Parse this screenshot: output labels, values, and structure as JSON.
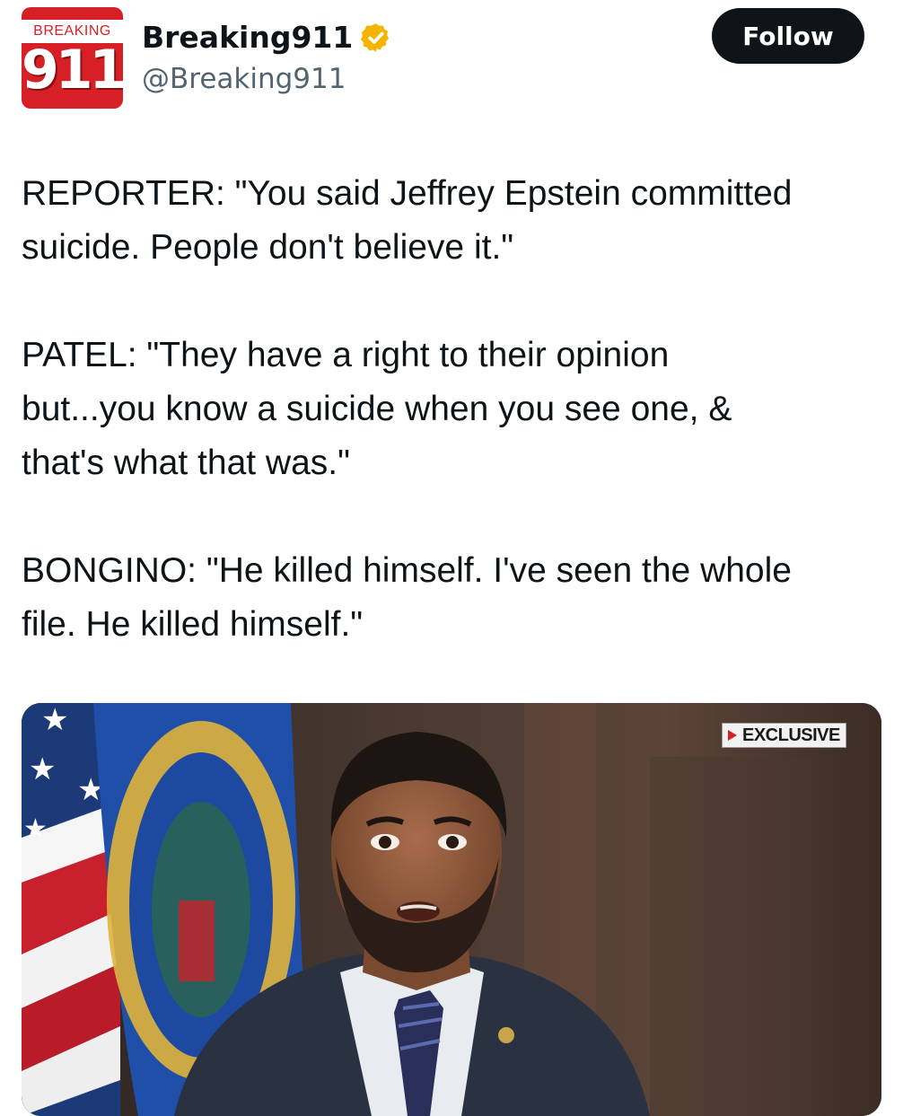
{
  "account": {
    "avatar_word": "BREAKING",
    "avatar_number": "911",
    "display_name": "Breaking911",
    "handle": "@Breaking911",
    "verified_icon": "verified-badge-icon",
    "verified_color": "#f4b400"
  },
  "follow_button": {
    "label": "Follow"
  },
  "tweet": {
    "paragraphs": [
      "REPORTER: \"You said Jeffrey Epstein committed\nsuicide. People don't believe it.\"",
      "PATEL: \"They have a right to their opinion\nbut...you know a suicide when you see one, &\nthat's what that was.\"",
      "BONGINO: \"He killed himself. I've seen the whole\nfile. He killed himself.\""
    ]
  },
  "media": {
    "badge_label": "EXCLUSIVE",
    "badge_icon": "play-triangle-icon"
  },
  "colors": {
    "text": "#0f1419",
    "secondary": "#536471",
    "brand_red": "#d71f26",
    "button_bg": "#0f1419"
  }
}
